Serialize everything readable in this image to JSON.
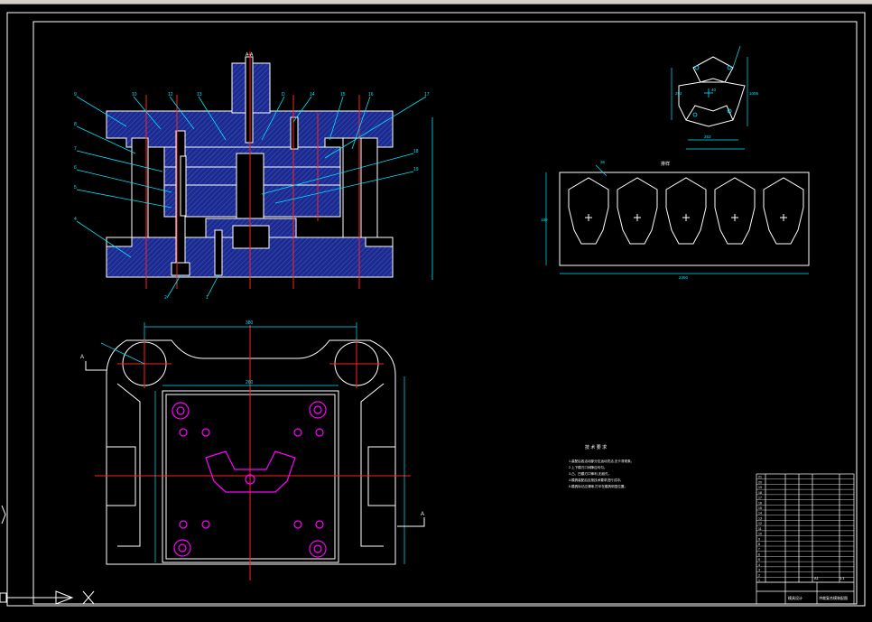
{
  "window": {
    "title_visible": false
  },
  "colors": {
    "background": "#000000",
    "outline": "#ffffff",
    "hatch": "#2a3aa8",
    "centerline": "#ff2020",
    "dimension": "#00e5ff",
    "hole": "#ff00ff",
    "frame": "#ffffff",
    "leader": "#00e5ff",
    "highlight": "#ffff00"
  },
  "labels": {
    "section_marker": "A-A",
    "section_a_left": "A",
    "section_a_right": "A",
    "strip_label": "排样",
    "tech_requirements_title": "技 术 要 求",
    "tech_requirements": [
      "1.装配后各活动部分应运动灵活,无卡滞现象。",
      "2.上下模刃口间隙应均匀。",
      "3.凸、凹模刃口锋利,无崩刃。",
      "4.模具装配后应按技术要求进行试冲。",
      "5.模具标记应清晰,打印在模具明显位置。"
    ],
    "strip_width": "180",
    "strip_length": "2350",
    "strip_step": "36",
    "part_w": "263",
    "part_h": "292",
    "part_h2": "1006",
    "part_small": "40",
    "die_width": "380",
    "die_inner": "260"
  },
  "title_block": {
    "scale": "1:1",
    "sheet": "A1",
    "name": "冲裁复合模装配图",
    "school": "模具设计",
    "rows": [
      "21",
      "20",
      "19",
      "18",
      "17",
      "16",
      "15",
      "14",
      "13",
      "12",
      "11",
      "10",
      "9",
      "8",
      "7",
      "6",
      "5",
      "4",
      "3",
      "2",
      "1"
    ]
  }
}
